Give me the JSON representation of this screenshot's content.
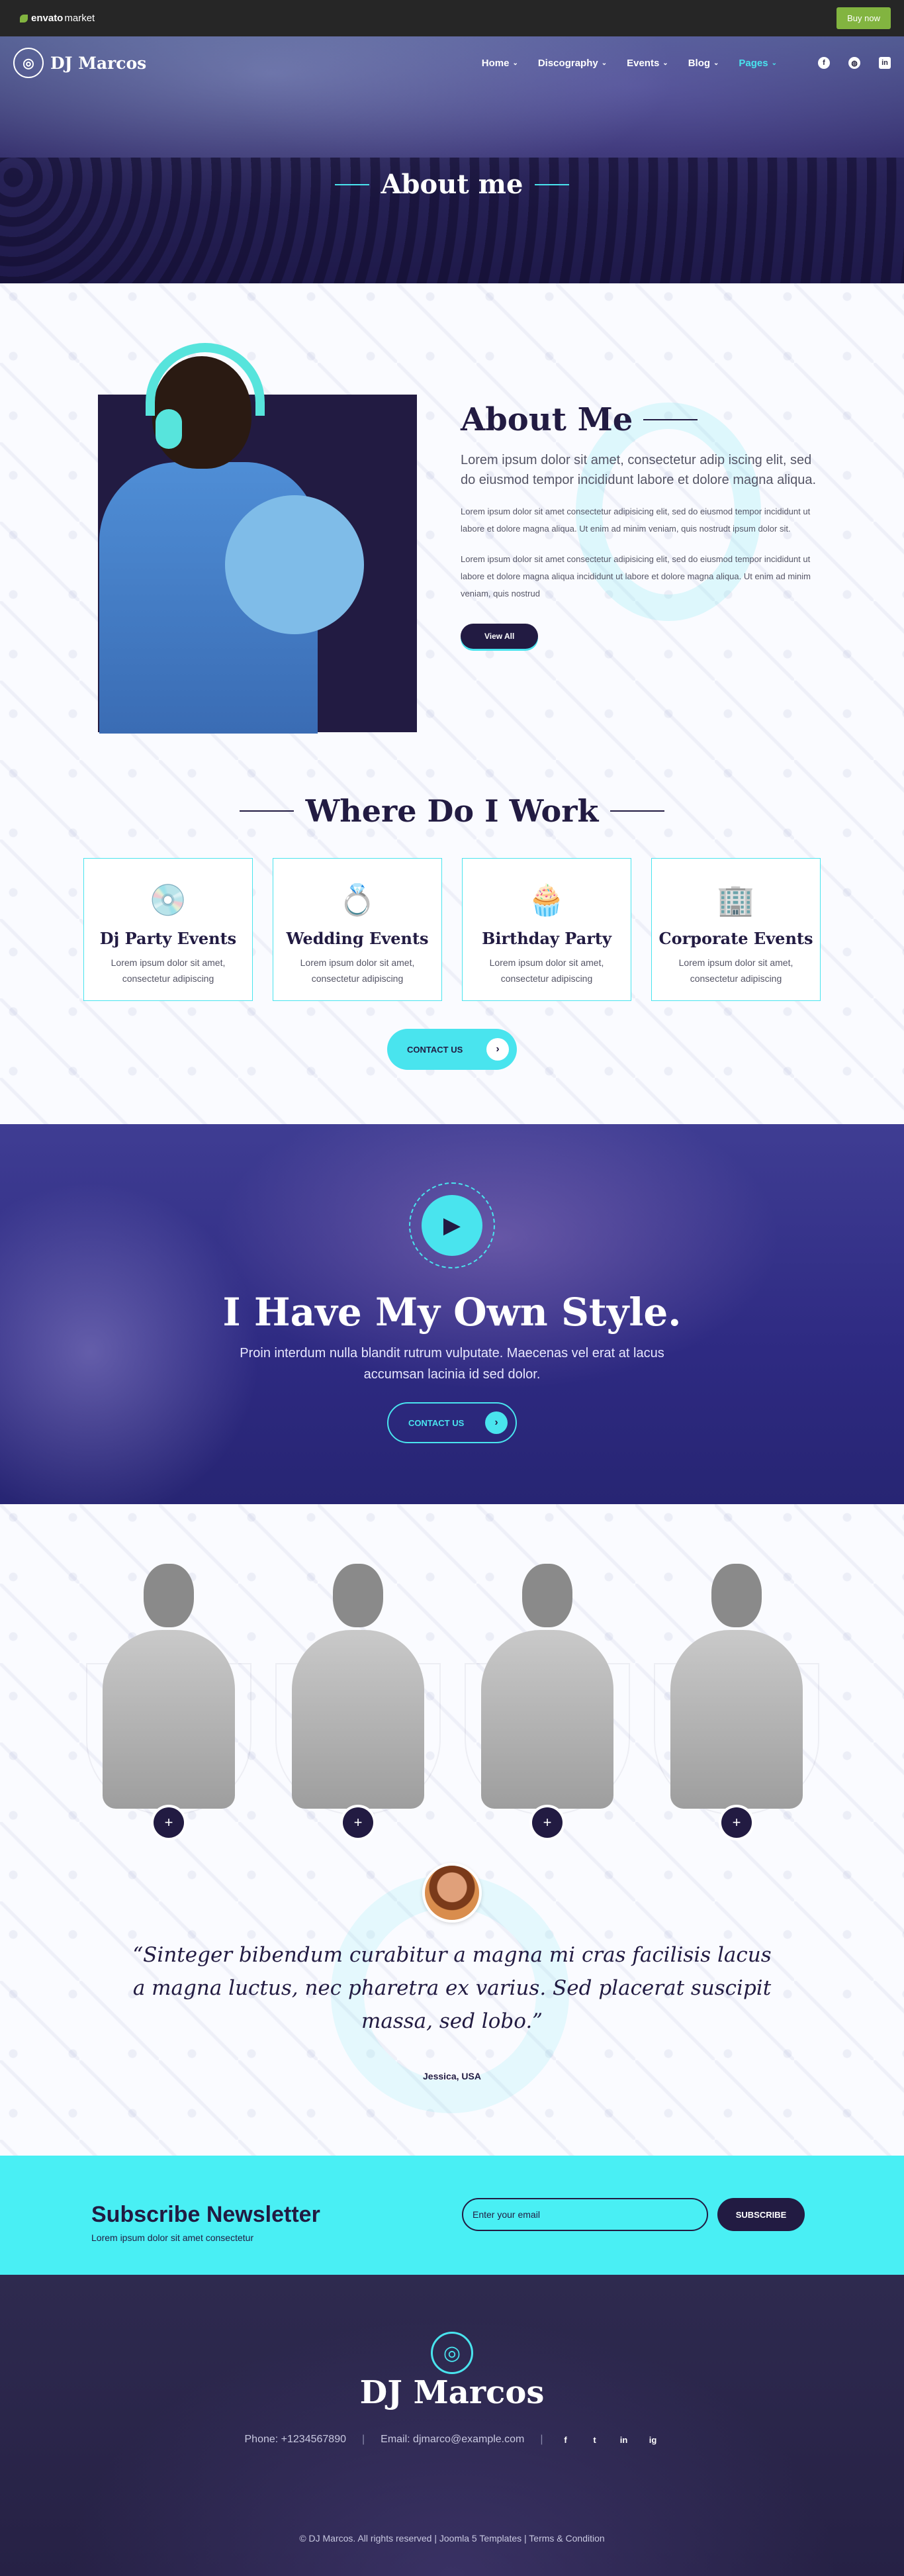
{
  "envato": {
    "logo_bold": "envato",
    "logo_light": "market",
    "buy_button": "Buy now"
  },
  "nav": {
    "brand": "DJ Marcos",
    "items": [
      {
        "label": "Home",
        "active": false
      },
      {
        "label": "Discography",
        "active": false
      },
      {
        "label": "Events",
        "active": false
      },
      {
        "label": "Blog",
        "active": false
      },
      {
        "label": "Pages",
        "active": true
      }
    ],
    "socials": [
      "facebook-icon",
      "dribbble-icon",
      "linkedin-icon"
    ]
  },
  "hero": {
    "title": "About me"
  },
  "about": {
    "heading": "About Me",
    "lead": "Lorem ipsum dolor sit amet, consectetur adip iscing elit, sed do eiusmod tempor incididunt labore et dolore magna aliqua.",
    "para1": "Lorem ipsum dolor sit amet consectetur adipisicing elit, sed do eiusmod tempor incididunt ut labore et dolore magna aliqua. Ut enim ad minim veniam, quis nostrudt ipsum dolor sit.",
    "para2": "Lorem ipsum dolor sit amet consectetur adipisicing elit, sed do eiusmod tempor incididunt ut labore et dolore magna aliqua incididunt ut labore et dolore magna aliqua. Ut enim ad minim veniam, quis nostrud",
    "button": "View All"
  },
  "work": {
    "heading": "Where Do I Work",
    "cards": [
      {
        "title": "Dj Party Events",
        "text": "Lorem ipsum dolor sit amet, consectetur adipiscing",
        "icon": "dj-disc-icon"
      },
      {
        "title": "Wedding Events",
        "text": "Lorem ipsum dolor sit amet, consectetur adipiscing",
        "icon": "ring-icon"
      },
      {
        "title": "Birthday Party",
        "text": "Lorem ipsum dolor sit amet, consectetur adipiscing",
        "icon": "cupcake-icon"
      },
      {
        "title": "Corporate Events",
        "text": "Lorem ipsum dolor sit amet, consectetur adipiscing",
        "icon": "building-icon"
      }
    ],
    "button": "CONTACT US"
  },
  "style_banner": {
    "title": "I Have My Own Style.",
    "text": "Proin interdum nulla blandit rutrum vulputate. Maecenas vel erat at lacus accumsan lacinia id sed dolor.",
    "button": "CONTACT US"
  },
  "team": {
    "members": [
      "+",
      "+",
      "+",
      "+"
    ]
  },
  "testimonial": {
    "quote": "“Sinteger bibendum curabitur a magna mi cras facilisis lacus a magna luctus, nec pharetra ex varius. Sed placerat suscipit massa, sed lobo.”",
    "author": "Jessica, USA"
  },
  "newsletter": {
    "title": "Subscribe Newsletter",
    "subtitle": "Lorem ipsum dolor sit amet consectetur",
    "placeholder": "Enter your email",
    "button": "SUBSCRIBE"
  },
  "footer": {
    "brand": "DJ Marcos",
    "phone": "Phone: +1234567890",
    "email": "Email: djmarco@example.com",
    "socials": [
      "f",
      "t",
      "in",
      "ig"
    ],
    "copyright": "© DJ Marcos. All rights reserved | Joomla 5 Templates | Terms & Condition"
  },
  "colors": {
    "accent": "#49e4ee",
    "dark": "#221b42",
    "envato_green": "#82b440"
  }
}
